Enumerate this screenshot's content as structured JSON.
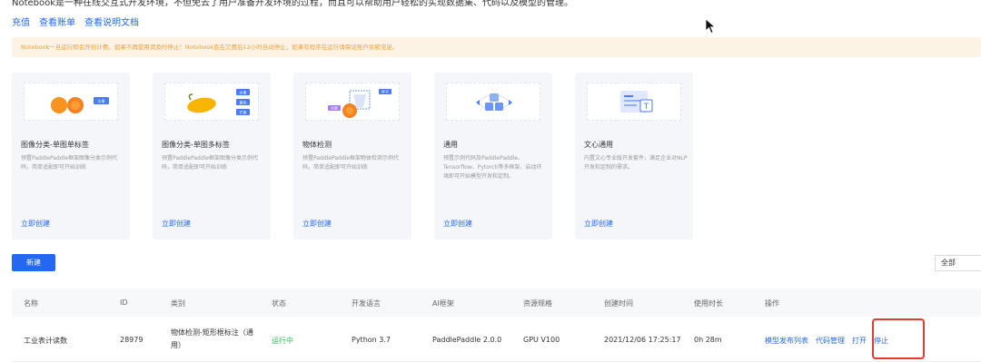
{
  "intro": {
    "text": "Notebook是一种在线交互式开发环境，不但免去了用户准备开发环境的过程，而且可以帮助用户轻松的实现数据集、代码以及模型的管理。"
  },
  "links": {
    "recharge": "充值",
    "view_bill": "查看账单",
    "view_docs": "查看说明文档"
  },
  "notice": {
    "text": "Notebook一旦运行即会开始计费。如果不再使用请及时停止！Notebook会在欠费后12小时自动停止，如果有程序在运行请保证账户余额充足。"
  },
  "cards": [
    {
      "title": "图像分类-单图单标签",
      "desc": "预置PaddlePaddle框架图像分类示例代码，简单适配即可开始训练",
      "link": "立即创建",
      "tags": [
        "水果"
      ]
    },
    {
      "title": "图像分类-单图多标签",
      "desc": "预置PaddlePaddle框架图像分类示例代码，简单适配即可开始训练",
      "link": "立即创建",
      "tags": [
        "水果",
        "黄色",
        "芒果"
      ]
    },
    {
      "title": "物体检测",
      "desc": "预置PaddlePaddle框架物体检测示例代码，简单适配即可开始训练",
      "link": "立即创建",
      "tags": [
        "水果",
        "杯子"
      ]
    },
    {
      "title": "通用",
      "desc": "预置示例代码及PaddlePaddle、Tensorflow、Pytorch等多框架，启动环境即可开始模型开发和定制。",
      "link": "立即创建",
      "tags": []
    },
    {
      "title": "文心通用",
      "desc": "内置文心专业版开发套件，满足企业对NLP开发和定制的需求。",
      "link": "立即创建",
      "tags": [
        "T"
      ]
    }
  ],
  "toolbar": {
    "new_label": "新建",
    "filter_value": "全部"
  },
  "table": {
    "headers": [
      "名称",
      "ID",
      "类别",
      "状态",
      "开发语言",
      "AI框架",
      "资源规格",
      "创建时间",
      "使用时长",
      "操作"
    ],
    "rows": [
      {
        "name": "工业表计读数",
        "id": "28979",
        "category_line1": "物体检测-矩形框标注（通",
        "category_line2": "用）",
        "status": "运行中",
        "language": "Python 3.7",
        "framework": "PaddlePaddle 2.0.0",
        "resource": "GPU V100",
        "created": "2021/12/06 17:25:17",
        "duration": "0h 28m",
        "ops": [
          "模型发布列表",
          "代码管理",
          "打开",
          "停止"
        ]
      }
    ]
  },
  "colors": {
    "accent": "#2468f2",
    "running": "#2fbf5a",
    "highlight": "#e53a2e",
    "notice_bg": "#fdf3e4",
    "notice_text": "#f0a040"
  }
}
